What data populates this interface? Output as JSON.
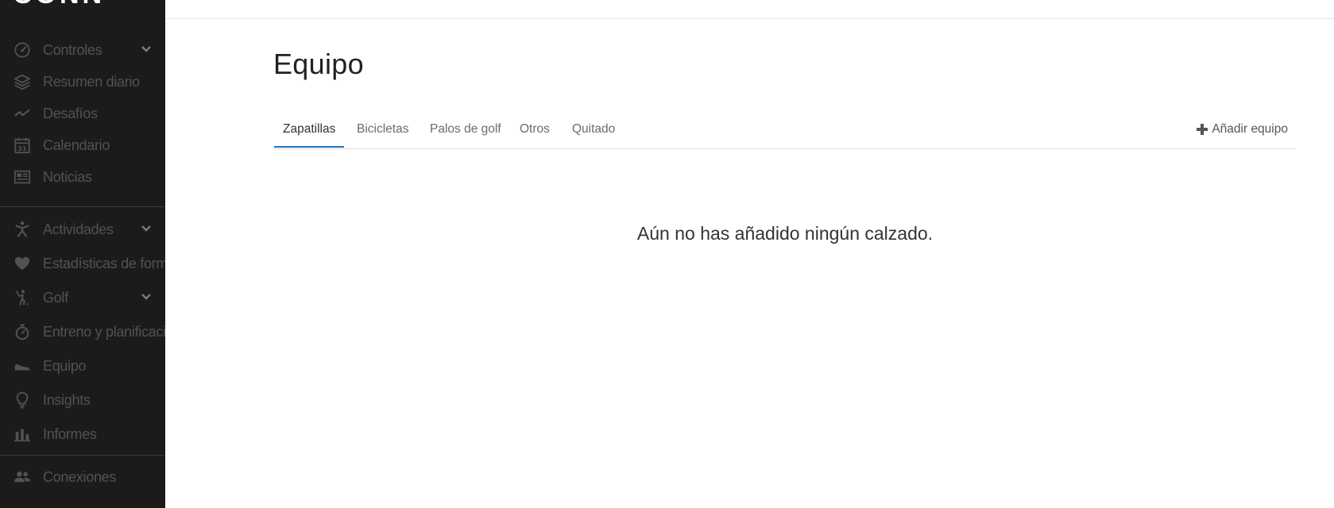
{
  "sidebar": {
    "logo": "CONN",
    "items": [
      {
        "label": "Controles",
        "icon": "speedometer-icon",
        "has_chevron": true
      },
      {
        "label": "Resumen diario",
        "icon": "layers-icon",
        "has_chevron": false
      },
      {
        "label": "Desafíos",
        "icon": "trend-icon",
        "has_chevron": false
      },
      {
        "label": "Calendario",
        "icon": "calendar-icon",
        "has_chevron": false,
        "icon_text": "31"
      },
      {
        "label": "Noticias",
        "icon": "newspaper-icon",
        "has_chevron": false
      },
      {
        "label": "Actividades",
        "icon": "person-icon",
        "has_chevron": true
      },
      {
        "label": "Estadísticas de forma",
        "icon": "heart-icon",
        "has_chevron": false
      },
      {
        "label": "Golf",
        "icon": "golfer-icon",
        "has_chevron": true
      },
      {
        "label": "Entreno y planificación",
        "icon": "stopwatch-icon",
        "has_chevron": false
      },
      {
        "label": "Equipo",
        "icon": "shoe-icon",
        "has_chevron": false
      },
      {
        "label": "Insights",
        "icon": "lightbulb-icon",
        "has_chevron": false
      },
      {
        "label": "Informes",
        "icon": "bar-chart-icon",
        "has_chevron": false
      },
      {
        "label": "Conexiones",
        "icon": "people-icon",
        "has_chevron": false
      }
    ]
  },
  "main": {
    "title": "Equipo",
    "tabs": [
      {
        "label": "Zapatillas",
        "active": true
      },
      {
        "label": "Bicicletas",
        "active": false
      },
      {
        "label": "Palos de golf",
        "active": false
      },
      {
        "label": "Otros",
        "active": false
      },
      {
        "label": "Quitado",
        "active": false
      }
    ],
    "add_label": "Añadir equipo",
    "empty_message": "Aún no has añadido ningún calzado."
  },
  "colors": {
    "sidebar_bg": "#1b1b1b",
    "sidebar_text": "#525252",
    "tab_active_underline": "#1a73c9"
  }
}
